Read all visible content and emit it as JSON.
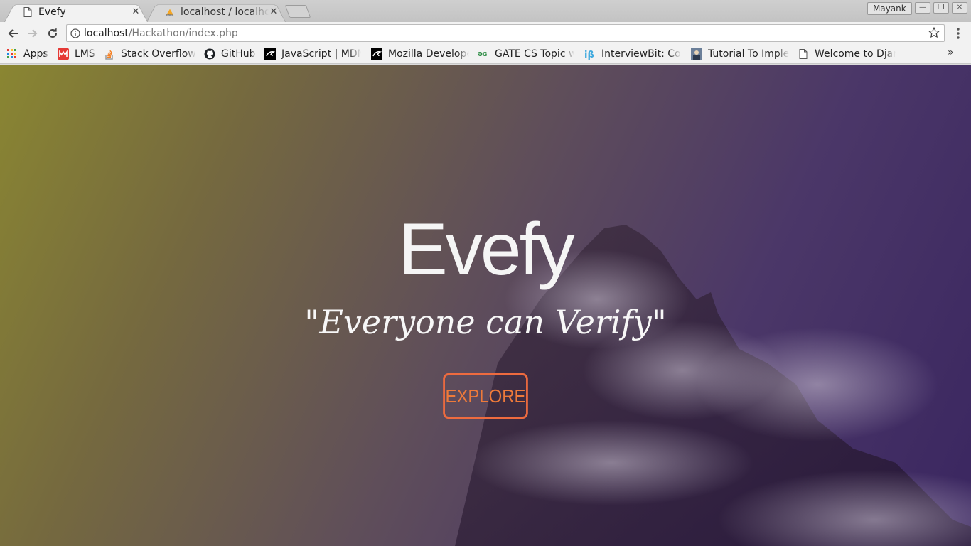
{
  "browser": {
    "tabs": [
      {
        "title": "Evefy",
        "active": true,
        "favicon": "document-icon"
      },
      {
        "title": "localhost / localhost",
        "active": false,
        "favicon": "phpmyadmin-icon"
      }
    ],
    "profile_name": "Mayank",
    "address": {
      "host": "localhost",
      "path": "/Hackathon/index.php"
    },
    "bookmarks": [
      {
        "label": "Apps",
        "icon": "apps-grid-icon"
      },
      {
        "label": "LMS",
        "icon": "lms-icon"
      },
      {
        "label": "Stack Overflow",
        "icon": "stackoverflow-icon"
      },
      {
        "label": "GitHub",
        "icon": "github-icon"
      },
      {
        "label": "JavaScript | MDN",
        "icon": "mdn-icon"
      },
      {
        "label": "Mozilla Develope",
        "icon": "mdn-icon"
      },
      {
        "label": "GATE CS Topic w",
        "icon": "geeksforgeeks-icon"
      },
      {
        "label": "InterviewBit: Co",
        "icon": "interviewbit-icon"
      },
      {
        "label": "Tutorial To Imple",
        "icon": "tutorial-avatar-icon"
      },
      {
        "label": "Welcome to Djar",
        "icon": "document-icon"
      }
    ],
    "overflow_label": "»"
  },
  "hero": {
    "title": "Evefy",
    "tagline": "\"Everyone can Verify\"",
    "button_label": "EXPLORE"
  },
  "colors": {
    "button_accent": "#ee6b3f",
    "overlay_start": "#8a8632",
    "overlay_end": "#3a2660"
  }
}
